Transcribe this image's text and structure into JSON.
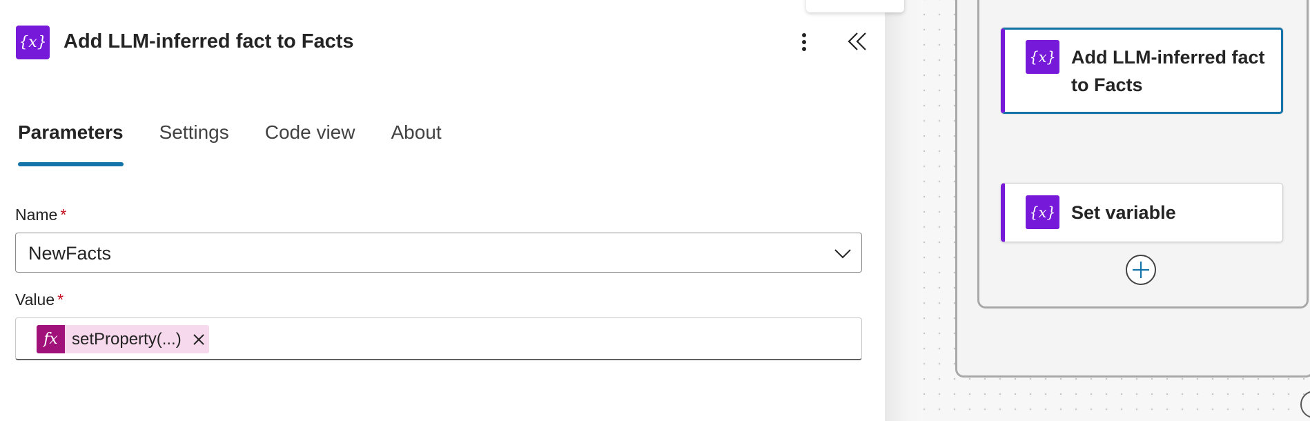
{
  "panel": {
    "title": "Add LLM-inferred fact to Facts",
    "icon": "variable-icon",
    "icon_glyph": "{x}",
    "icon_color": "#7719d9"
  },
  "tabs": [
    {
      "label": "Parameters",
      "active": true
    },
    {
      "label": "Settings",
      "active": false
    },
    {
      "label": "Code view",
      "active": false
    },
    {
      "label": "About",
      "active": false
    }
  ],
  "form": {
    "name_label": "Name",
    "name_required": "*",
    "name_value": "NewFacts",
    "value_label": "Value",
    "value_required": "*",
    "token_icon": "fx",
    "token_text": "setProperty(...)",
    "token_color": "#a0117a"
  },
  "canvas": {
    "cards": [
      {
        "title": "Add LLM-inferred fact to Facts",
        "selected": true,
        "icon_glyph": "{x}"
      },
      {
        "title": "Set variable",
        "selected": false,
        "icon_glyph": "{x}"
      }
    ],
    "accent": "#1473a8"
  }
}
